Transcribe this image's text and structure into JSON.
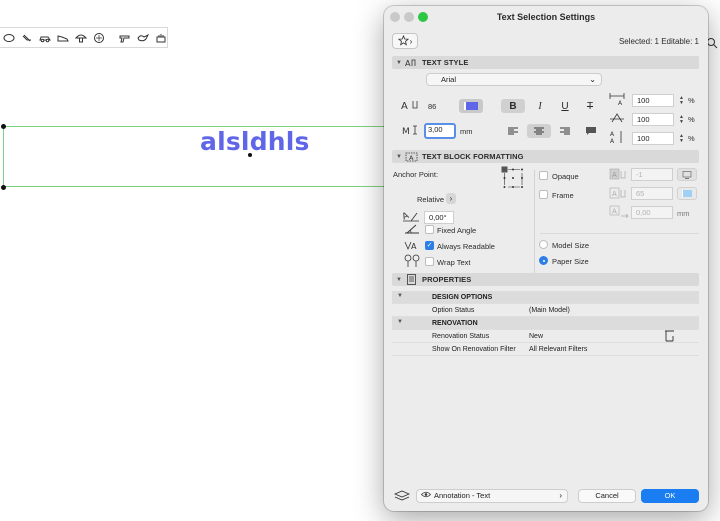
{
  "canvas": {
    "text": "alsldhls",
    "text_color": "#5f67e8",
    "selection_color": "#7dd07d",
    "toolbar_icons": [
      "ellipse-tool-icon",
      "eraser-tool-icon",
      "car-tool-icon",
      "shoe-tool-icon",
      "mushroom-tool-icon",
      "face-tool-icon",
      "gun-tool-icon",
      "bird-tool-icon",
      "cake-tool-icon"
    ]
  },
  "dialog": {
    "title": "Text Selection Settings",
    "selected_info": "Selected: 1 Editable: 1",
    "text_style": {
      "header": "TEXT STYLE",
      "font": "Arial",
      "size": "86",
      "bold": true,
      "italic": false,
      "underline": false,
      "strikethrough": false,
      "pen_value": "3,00",
      "pen_unit": "mm",
      "alignment": "center",
      "width_factor": "100",
      "spacing_factor": "100",
      "line_spacing": "100",
      "percent": "%",
      "pen_color": "#5f67e8"
    },
    "block": {
      "header": "TEXT BLOCK FORMATTING",
      "anchor_label": "Anchor Point:",
      "relative_label": "Relative",
      "angle": "0,00°",
      "fixed_angle_label": "Fixed Angle",
      "fixed_angle": false,
      "always_readable_label": "Always Readable",
      "always_readable": true,
      "wrap_text_label": "Wrap Text",
      "wrap_text": false,
      "opaque_label": "Opaque",
      "opaque": false,
      "opaque_pen": "-1",
      "frame_label": "Frame",
      "frame": false,
      "frame_pen": "65",
      "frame_offset": "0,00",
      "frame_offset_unit": "mm",
      "model_size_label": "Model Size",
      "paper_size_label": "Paper Size",
      "size_mode": "paper"
    },
    "properties": {
      "header": "PROPERTIES",
      "groups": [
        {
          "name": "DESIGN OPTIONS",
          "rows": [
            {
              "name": "Option Status",
              "value": "(Main Model)"
            }
          ]
        },
        {
          "name": "RENOVATION",
          "rows": [
            {
              "name": "Renovation Status",
              "value": "New"
            },
            {
              "name": "Show On Renovation Filter",
              "value": "All Relevant Filters"
            }
          ]
        }
      ]
    },
    "footer": {
      "layer": "Annotation - Text",
      "cancel": "Cancel",
      "ok": "OK"
    }
  }
}
